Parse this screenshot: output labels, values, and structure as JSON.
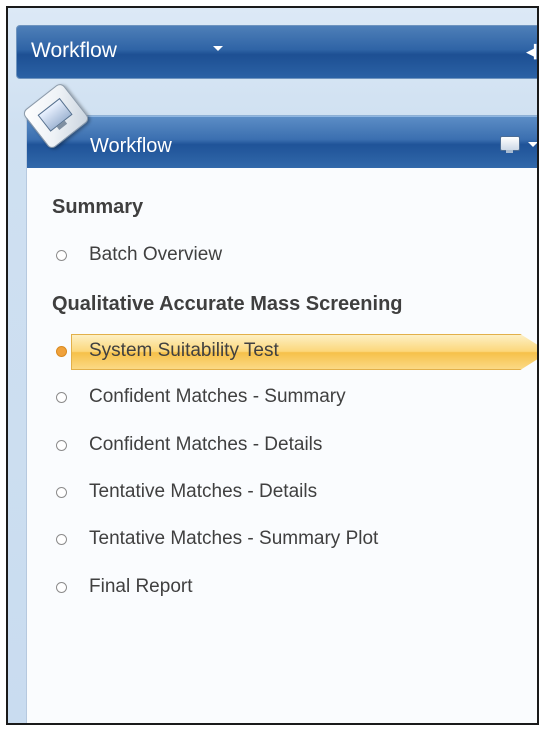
{
  "topbar": {
    "title": "Workflow",
    "dropdown_icon": "chevron-down-icon",
    "collapse_icon": "collapse-left-icon"
  },
  "panel": {
    "title": "Workflow",
    "badge_icon": "computer-icon",
    "tool_icon": "monitor-icon",
    "tool_dropdown_icon": "chevron-down-icon"
  },
  "sections": [
    {
      "label": "Summary",
      "items": [
        {
          "label": "Batch Overview",
          "active": false
        }
      ]
    },
    {
      "label": "Qualitative Accurate Mass Screening",
      "items": [
        {
          "label": "System Suitability Test",
          "active": true
        },
        {
          "label": "Confident Matches - Summary",
          "active": false
        },
        {
          "label": "Confident Matches - Details",
          "active": false
        },
        {
          "label": "Tentative Matches - Details",
          "active": false
        },
        {
          "label": "Tentative Matches - Summary Plot",
          "active": false
        },
        {
          "label": "Final Report",
          "active": false
        }
      ]
    }
  ],
  "colors": {
    "header_blue": "#2f64a6",
    "highlight": "#fcd77b",
    "active_dot": "#f0a23c",
    "text": "#404040"
  }
}
